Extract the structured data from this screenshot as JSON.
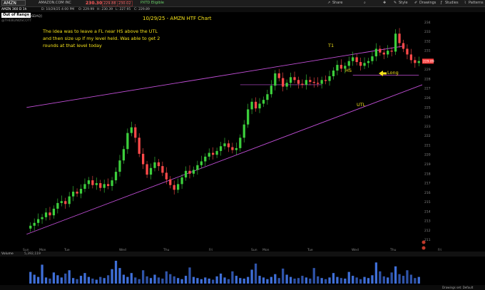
{
  "toolbar": {
    "symbol": "AMZN",
    "company": "AMAZON.COM INC",
    "last_price": "230.30",
    "bid": "229.88",
    "ask": "230.02",
    "badge": "PXTD Eligible",
    "share_label": "Share",
    "style_label": "Style",
    "drawings_label": "Drawings",
    "studies_label": "Studies",
    "patterns_label": "Patterns"
  },
  "subbar": {
    "period": "AMZN 360 D 1h",
    "datetime": "D: 10/29/25 4:00 PM",
    "open": "O: 229.99",
    "high": "H: 230.39",
    "low": "L: 227.95",
    "close": "C: 229.89"
  },
  "market_label": "[NASDAQ]",
  "watermark": "@THEBLINDSCOTT",
  "out_of_range": "Out of Range",
  "chart_title": "10/29/25 - AMZN HTF Chart",
  "note_text": "The idea was to leave a FL near HS above the UTL and then size up if my level held. Was able to get 2 rounds at that level today",
  "annotations": {
    "t1": "T1",
    "hs": "HS",
    "long": "Long",
    "utl": "UTL"
  },
  "current_price_tag": "229.89",
  "volume_label": "Volume",
  "volume_value": "5,392,119",
  "bottom_labels": [
    "Sun",
    "Mon",
    "Tue",
    "Wed",
    "Thu",
    "Fri",
    "Sun",
    "Mon",
    "Tue",
    "Wed",
    "Thu",
    "Fri",
    "Drawings set: Default"
  ],
  "colors": {
    "up": "#3ccf3c",
    "down": "#ff4a4a",
    "channel": "#c24fd8",
    "annotation": "#f5e21a",
    "price_tag": "#ff3b3b"
  },
  "chart_data": {
    "type": "candlestick",
    "ylim": [
      210,
      235
    ],
    "y_ticks": [
      211,
      212,
      213,
      214,
      215,
      216,
      217,
      218,
      219,
      220,
      221,
      222,
      223,
      224,
      225,
      226,
      227,
      228,
      229,
      230,
      231,
      232,
      233,
      234
    ],
    "x_ticks": [
      "Sun",
      "Mon",
      "Tue",
      "Wed",
      "Thu",
      "Fri",
      "Sun",
      "Mon",
      "Tue",
      "Wed",
      "Thu",
      "Fri"
    ],
    "closes": [
      212.5,
      212.8,
      213.2,
      213.4,
      213.9,
      213.6,
      214.3,
      214.9,
      215.1,
      214.8,
      215.6,
      216.1,
      215.9,
      216.4,
      216.9,
      217.3,
      216.8,
      217.0,
      216.5,
      216.9,
      216.7,
      217.3,
      218.2,
      219.4,
      220.6,
      222.3,
      222.9,
      221.8,
      220.1,
      219.0,
      217.9,
      218.6,
      219.2,
      218.8,
      218.1,
      217.4,
      216.8,
      216.3,
      216.9,
      217.6,
      218.3,
      218.0,
      218.4,
      218.9,
      219.3,
      219.8,
      220.2,
      220.0,
      220.4,
      220.9,
      221.2,
      220.8,
      220.5,
      220.7,
      221.8,
      223.2,
      224.8,
      225.6,
      224.9,
      225.4,
      225.8,
      226.4,
      227.3,
      228.6,
      228.1,
      227.2,
      227.6,
      228.2,
      227.9,
      227.5,
      227.4,
      227.9,
      227.7,
      227.6,
      227.5,
      227.9,
      227.8,
      228.3,
      228.9,
      229.5,
      229.1,
      229.4,
      229.9,
      230.3,
      229.8,
      229.4,
      229.7,
      229.9,
      230.4,
      231.2,
      230.8,
      230.6,
      231.0,
      230.9,
      232.8,
      231.8,
      231.2,
      230.6,
      230.0,
      229.7,
      229.9
    ],
    "volume": [
      2.1,
      1.6,
      1.2,
      3.4,
      1.1,
      0.9,
      2.0,
      1.5,
      1.1,
      1.8,
      2.4,
      1.0,
      0.8,
      1.4,
      1.9,
      1.2,
      0.9,
      0.7,
      1.2,
      1.0,
      1.5,
      2.6,
      4.1,
      2.8,
      1.6,
      1.2,
      1.9,
      1.1,
      0.8,
      2.4,
      1.3,
      1.0,
      1.6,
      1.1,
      0.9,
      2.2,
      1.7,
      1.3,
      1.0,
      0.8,
      1.4,
      2.9,
      1.2,
      1.0,
      0.8,
      1.1,
      0.9,
      0.7,
      1.3,
      1.8,
      1.1,
      0.8,
      2.2,
      1.4,
      1.0,
      0.9,
      1.2,
      2.5,
      3.6,
      1.4,
      1.1,
      0.8,
      1.2,
      1.7,
      1.0,
      2.7,
      1.6,
      1.2,
      0.9,
      1.0,
      1.4,
      1.1,
      0.9,
      2.8,
      1.3,
      1.0,
      0.8,
      1.1,
      1.9,
      1.2,
      1.0,
      0.9,
      2.1,
      1.4,
      1.1,
      0.8,
      1.2,
      1.0,
      1.5,
      3.8,
      2.2,
      1.3,
      1.1,
      2.0,
      3.1,
      1.7,
      1.4,
      2.4,
      1.6,
      1.0,
      1.2
    ],
    "channel_upper": [
      [
        212.5,
        225.0
      ],
      [
        231.0,
        231.5
      ]
    ],
    "channel_lower": [
      [
        0.0,
        211.6
      ],
      [
        1.0,
        228.4
      ]
    ],
    "hs_level": 227.4,
    "t1_level": 230.6
  }
}
